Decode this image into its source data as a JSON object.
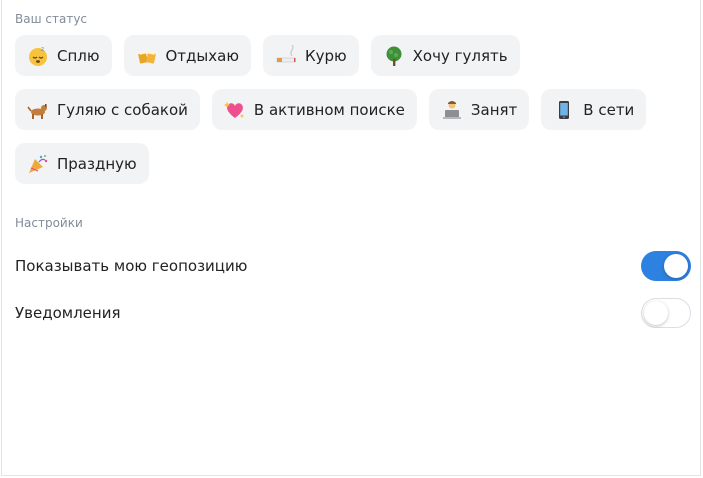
{
  "status_section": {
    "title": "Ваш статус",
    "chips": [
      {
        "label": "Сплю",
        "icon": "sleeping-face-icon"
      },
      {
        "label": "Отдыхаю",
        "icon": "beer-mugs-icon"
      },
      {
        "label": "Курю",
        "icon": "cigarette-icon"
      },
      {
        "label": "Хочу гулять",
        "icon": "tree-icon"
      },
      {
        "label": "Гуляю с собакой",
        "icon": "dog-icon"
      },
      {
        "label": "В активном поиске",
        "icon": "sparkling-heart-icon"
      },
      {
        "label": "Занят",
        "icon": "laptop-user-icon"
      },
      {
        "label": "В сети",
        "icon": "mobile-phone-icon"
      },
      {
        "label": "Праздную",
        "icon": "party-popper-icon"
      }
    ]
  },
  "settings_section": {
    "title": "Настройки",
    "show_location": {
      "label": "Показывать мою геопозицию",
      "enabled": true
    },
    "notifications": {
      "label": "Уведомления",
      "enabled": false
    }
  },
  "colors": {
    "accent": "#2d81e0",
    "chip_bg": "#f2f3f5",
    "section_label": "#818c99"
  }
}
